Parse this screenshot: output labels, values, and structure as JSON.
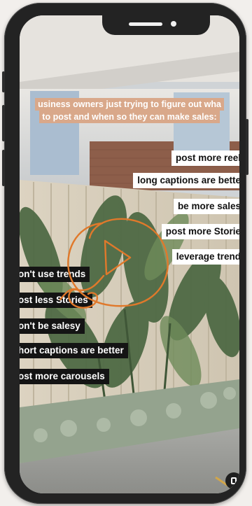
{
  "headline": {
    "lines": [
      "usiness owners just trying to figure out wha",
      "to post and when so they can make sales:"
    ]
  },
  "right_tips": [
    "post more reel",
    "long captions are bette",
    "be more sales",
    "post more Storie",
    "leverage trend"
  ],
  "left_tips": [
    "on't use trends",
    "ost less Stories",
    "on't be salesy",
    "hort captions are better",
    "ost more carousels"
  ],
  "colors": {
    "headline_bg": "#d9a88a",
    "scribble": "#e0792b",
    "frame": "#232323"
  },
  "icons": {
    "reel": "reel-icon"
  }
}
